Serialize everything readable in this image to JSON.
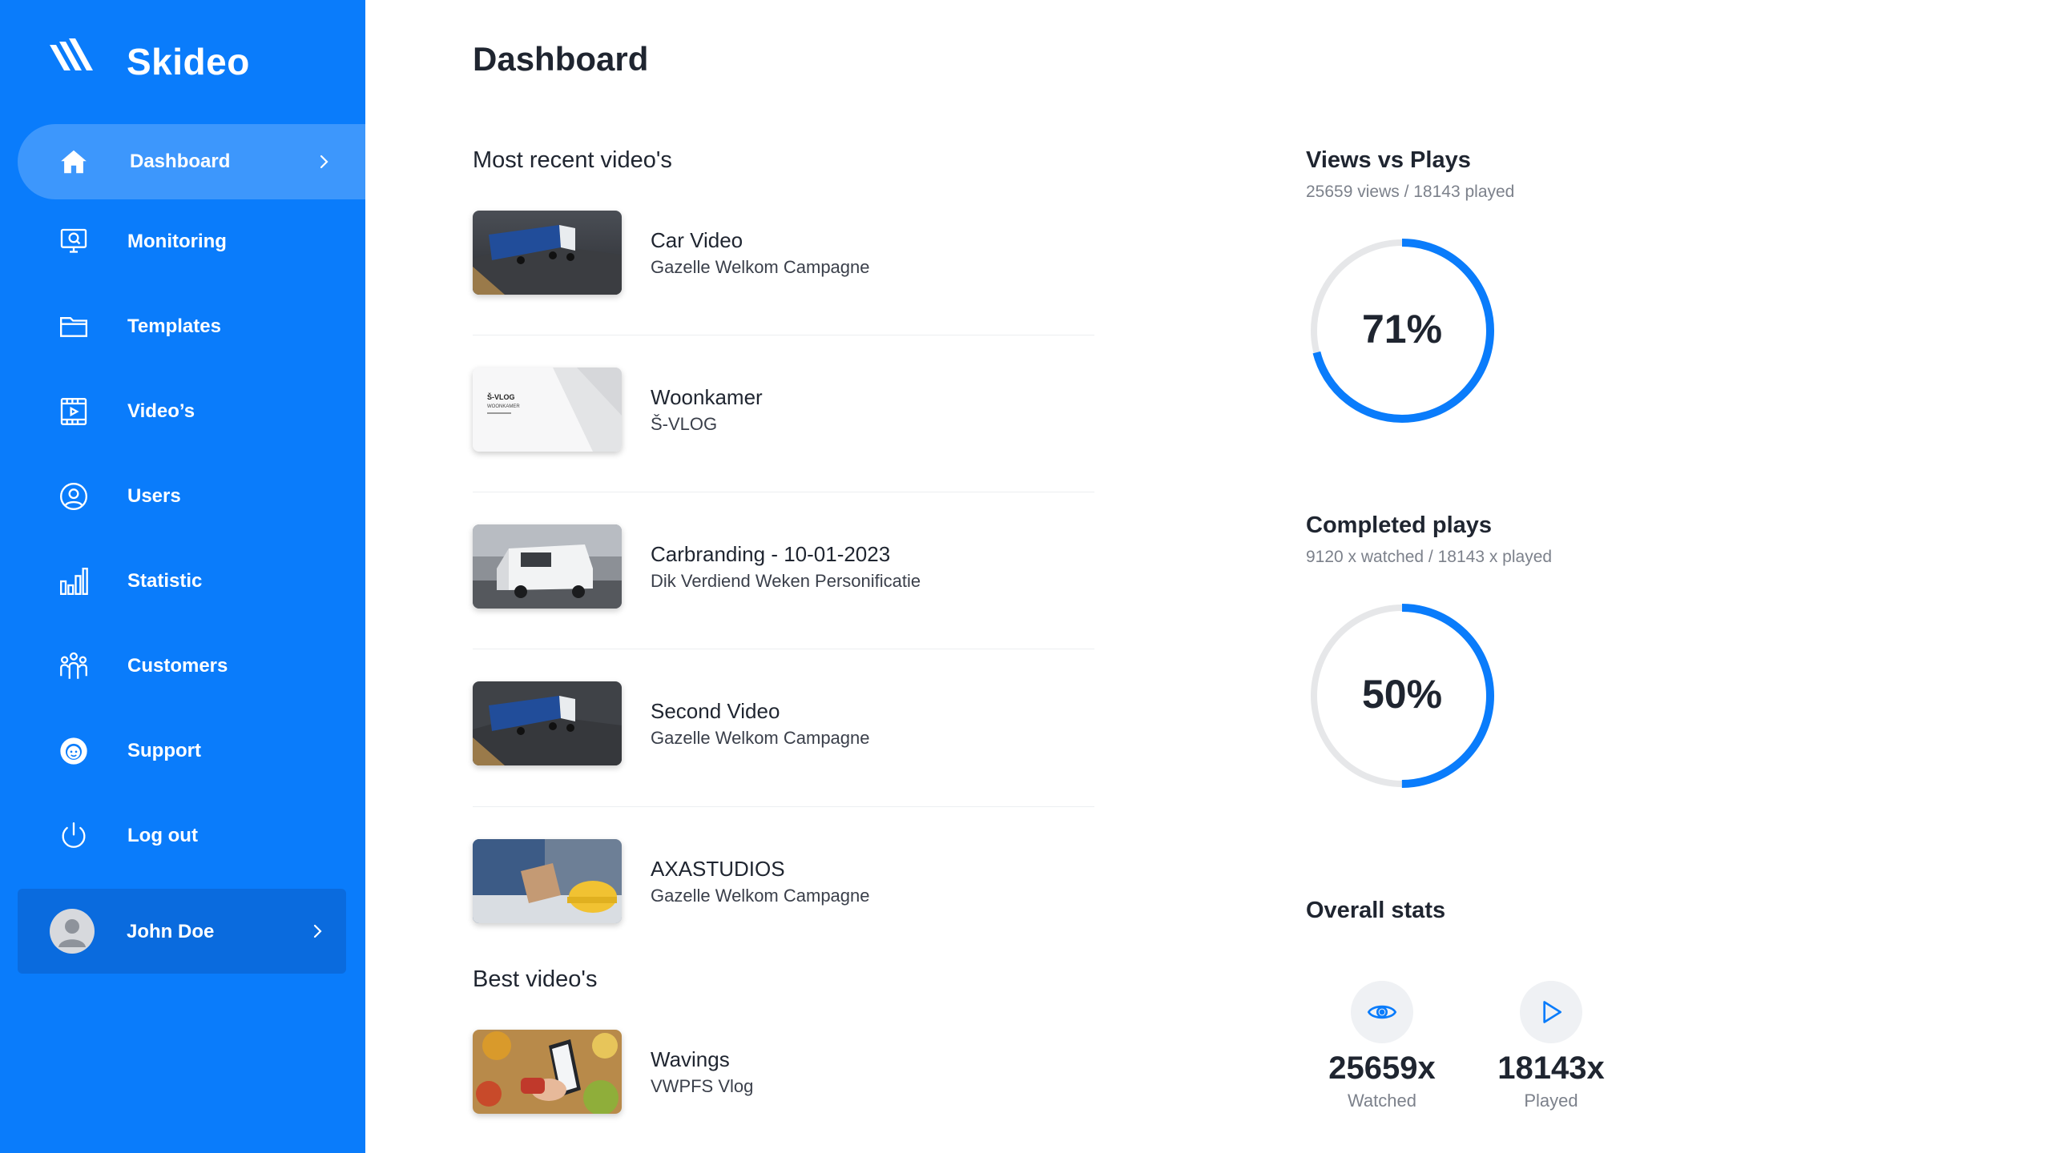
{
  "brand": {
    "name": "Skideo"
  },
  "sidebar": {
    "items": [
      {
        "label": "Dashboard",
        "icon": "home-icon",
        "active": true
      },
      {
        "label": "Monitoring",
        "icon": "monitor-search-icon"
      },
      {
        "label": "Templates",
        "icon": "folder-icon"
      },
      {
        "label": "Video’s",
        "icon": "film-play-icon"
      },
      {
        "label": "Users",
        "icon": "user-circle-icon"
      },
      {
        "label": "Statistic",
        "icon": "bar-chart-icon"
      },
      {
        "label": "Customers",
        "icon": "customers-group-icon"
      },
      {
        "label": "Support",
        "icon": "support-agent-icon"
      },
      {
        "label": "Log out",
        "icon": "power-icon"
      }
    ],
    "user": {
      "name": "John Doe"
    }
  },
  "main": {
    "title": "Dashboard",
    "recent_title": "Most recent video's",
    "recent": [
      {
        "title": "Car Video",
        "subtitle": "Gazelle Welkom Campagne"
      },
      {
        "title": "Woonkamer",
        "subtitle": "Š-VLOG"
      },
      {
        "title": "Carbranding - 10-01-2023",
        "subtitle": "Dik Verdiend Weken Personificatie"
      },
      {
        "title": "Second Video",
        "subtitle": "Gazelle Welkom Campagne"
      },
      {
        "title": "AXASTUDIOS",
        "subtitle": "Gazelle Welkom Campagne"
      }
    ],
    "best_title": "Best video's",
    "best": [
      {
        "title": "Wavings",
        "subtitle": "VWPFS Vlog"
      }
    ],
    "thumb_text": {
      "brand": "Š-VLOG",
      "room": "WOONKAMER"
    }
  },
  "stats": {
    "views_vs_plays": {
      "title": "Views vs Plays",
      "subtitle": "25659 views / 18143 played",
      "percent_label": "71%",
      "fraction": 0.71
    },
    "completed": {
      "title": "Completed plays",
      "subtitle": "9120 x watched / 18143 x played",
      "percent_label": "50%",
      "fraction": 0.5
    },
    "overall": {
      "title": "Overall stats",
      "watched": {
        "value": "25659x",
        "label": "Watched",
        "icon": "eye-icon"
      },
      "played": {
        "value": "18143x",
        "label": "Played",
        "icon": "play-icon"
      }
    }
  },
  "colors": {
    "primary": "#0a7cfb",
    "active_item": "#3d97fc",
    "user_card": "#0a6bde",
    "ring_track": "#e6e7e9"
  }
}
